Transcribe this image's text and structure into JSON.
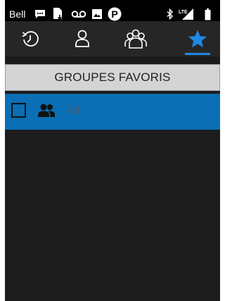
{
  "status_bar": {
    "carrier": "Bell",
    "icons": [
      "message-icon",
      "sim-download-icon",
      "voicemail-icon",
      "image-icon",
      "parking-icon",
      "bluetooth-icon",
      "lte-signal-icon",
      "battery-icon"
    ],
    "lte_label": "LTE"
  },
  "tabs": [
    {
      "name": "recent-calls",
      "icon": "history-icon"
    },
    {
      "name": "contacts",
      "icon": "person-icon"
    },
    {
      "name": "groups",
      "icon": "group-icon"
    },
    {
      "name": "favorites",
      "icon": "star-icon",
      "selected": true
    }
  ],
  "header": {
    "title": "GROUPES FAVORIS"
  },
  "groups": [
    {
      "label": "All",
      "checked": false
    }
  ],
  "colors": {
    "accent": "#1e88e5",
    "row_highlight": "#0a6fb4",
    "background": "#1c1c1c",
    "header_bg": "#d4d4d4"
  }
}
